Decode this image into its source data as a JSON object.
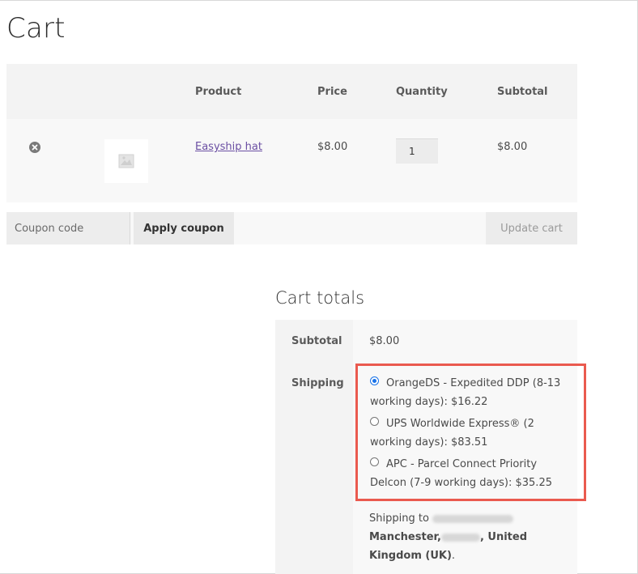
{
  "page": {
    "title": "Cart"
  },
  "cart_table": {
    "headers": {
      "product": "Product",
      "price": "Price",
      "quantity": "Quantity",
      "subtotal": "Subtotal"
    },
    "rows": [
      {
        "product": "Easyship hat",
        "price": "$8.00",
        "quantity": "1",
        "subtotal": "$8.00",
        "remove_icon": "remove-circle-icon",
        "thumbnail_icon": "image-placeholder-icon"
      }
    ]
  },
  "actions": {
    "coupon_placeholder": "Coupon code",
    "apply_coupon": "Apply coupon",
    "update_cart": "Update cart"
  },
  "cart_totals": {
    "title": "Cart totals",
    "subtotal_label": "Subtotal",
    "subtotal_value": "$8.00",
    "shipping_label": "Shipping",
    "shipping_options": [
      {
        "label": "OrangeDS - Expedited DDP (8-13 working days): $16.22",
        "selected": true
      },
      {
        "label": "UPS Worldwide Express® (2 working days): $83.51",
        "selected": false
      },
      {
        "label": "APC - Parcel Connect Priority Delcon (7-9 working days): $35.25",
        "selected": false
      }
    ],
    "shipping_to_prefix": "Shipping to",
    "shipping_city": "Manchester,",
    "shipping_country": ", United Kingdom (UK)",
    "shipping_period": "."
  },
  "colors": {
    "link": "#6b4fa3",
    "highlight_border": "#ea5a4f",
    "radio_selected": "#1a73e8"
  }
}
